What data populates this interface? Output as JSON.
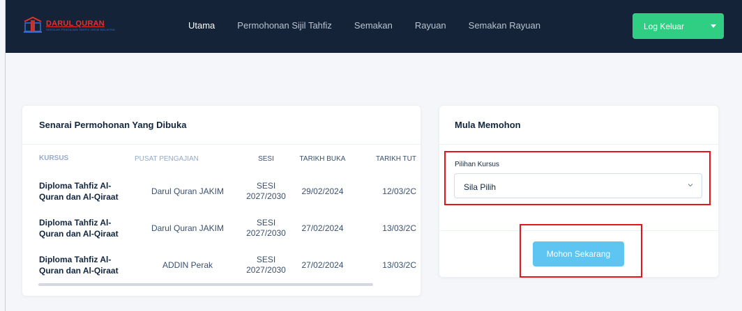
{
  "brand": {
    "title": "DARUL QURAN",
    "subtitle": "SEKOLAH PENGAJIAN TAHFIZ JAKIM MALAYSIA",
    "color_primary": "#e0332b",
    "color_secondary": "#3c6ed1"
  },
  "nav": {
    "items": [
      {
        "label": "Utama",
        "active": true
      },
      {
        "label": "Permohonan Sijil Tahfiz",
        "active": false
      },
      {
        "label": "Semakan",
        "active": false
      },
      {
        "label": "Rayuan",
        "active": false
      },
      {
        "label": "Semakan Rayuan",
        "active": false
      }
    ],
    "logout_label": "Log Keluar",
    "logout_color": "#2fce83"
  },
  "applications": {
    "title": "Senarai Permohonan Yang Dibuka",
    "columns": [
      "KURSUS",
      "PUSAT PENGAJIAN",
      "SESI",
      "TARIKH BUKA",
      "TARIKH TUT"
    ],
    "rows": [
      {
        "kursus": "Diploma Tahfiz Al-Quran dan Al-Qiraat",
        "pusat": "Darul Quran JAKIM",
        "sesi_a": "SESI",
        "sesi_b": "2027/2030",
        "buka": "29/02/2024",
        "tutup": "12/03/2C"
      },
      {
        "kursus": "Diploma Tahfiz Al-Quran dan Al-Qiraat",
        "pusat": "Darul Quran JAKIM",
        "sesi_a": "SESI",
        "sesi_b": "2027/2030",
        "buka": "27/02/2024",
        "tutup": "13/03/2C"
      },
      {
        "kursus": "Diploma Tahfiz Al-Quran dan Al-Qiraat",
        "pusat": "ADDIN Perak",
        "sesi_a": "SESI",
        "sesi_b": "2027/2030",
        "buka": "27/02/2024",
        "tutup": "13/03/2C"
      }
    ]
  },
  "apply": {
    "title": "Mula Memohon",
    "field_label": "Pilihan Kursus",
    "select_value": "Sila Pilih",
    "button_label": "Mohon Sekarang",
    "button_color": "#5ec4f2",
    "highlight_color": "#e8141b"
  }
}
